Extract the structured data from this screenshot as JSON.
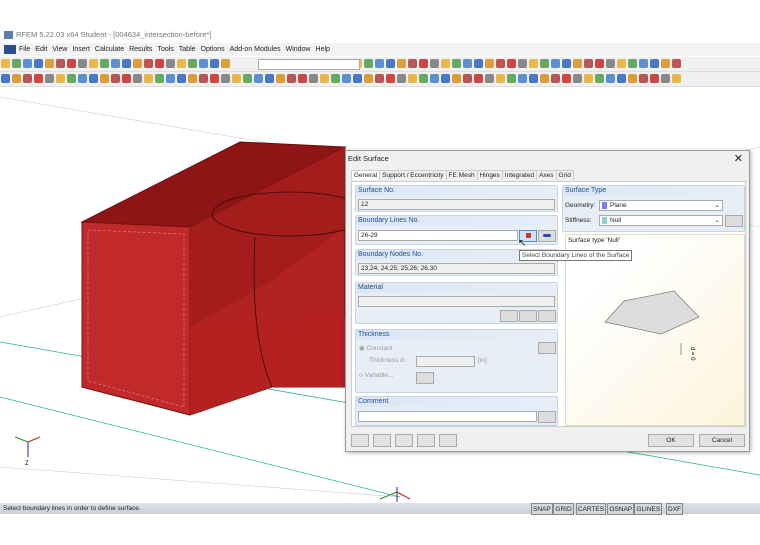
{
  "app": {
    "title": "RFEM 5.22.03 x64 Student - [004634_intersection-before*]"
  },
  "menu": [
    "File",
    "Edit",
    "View",
    "Insert",
    "Calculate",
    "Results",
    "Tools",
    "Table",
    "Options",
    "Add-on Modules",
    "Window",
    "Help"
  ],
  "status": {
    "message": "Select boundary lines in order to define surface.",
    "buttons": [
      "SNAP",
      "GRID",
      "CARTES",
      "OSNAP",
      "GLINES",
      "DXF"
    ]
  },
  "dialog": {
    "title": "Edit Surface",
    "tabs": [
      "General",
      "Support / Eccentricity",
      "FE Mesh",
      "Hinges",
      "Integrated",
      "Axes",
      "Grid"
    ],
    "surface_no": {
      "label": "Surface No.",
      "value": "12"
    },
    "boundary_lines": {
      "label": "Boundary Lines No.",
      "value": "26-29"
    },
    "boundary_nodes": {
      "label": "Boundary Nodes No.",
      "value": "23,24; 24,25; 25,26; 26,30"
    },
    "material": {
      "label": "Material",
      "value": ""
    },
    "thickness": {
      "label": "Thickness",
      "constant": "Constant",
      "thickness_d": "Thickness d:",
      "unit": "[in]",
      "variable": "Variable..."
    },
    "comment": {
      "label": "Comment",
      "value": ""
    },
    "surface_type": {
      "label": "Surface Type",
      "geometry_label": "Geometry:",
      "geometry": "Plane",
      "geometry_color": "#7b7bff",
      "stiffness_label": "Stiffness:",
      "stiffness": "Null",
      "stiffness_color": "#8fd0c8"
    },
    "preview_caption": "Surface type 'Null'",
    "preview_dim": "d = 0",
    "tooltip": "Select Boundary Lines of the Surface",
    "ok": "OK",
    "cancel": "Cancel"
  },
  "axes": {
    "z": "Z"
  }
}
